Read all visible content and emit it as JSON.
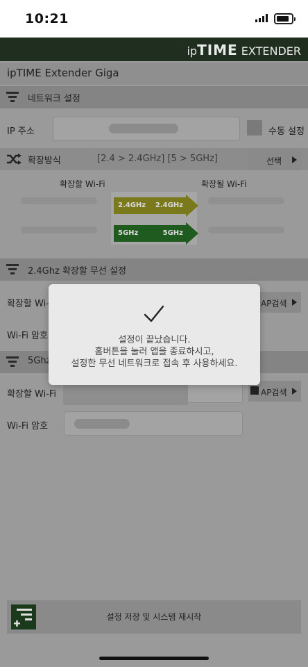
{
  "status_bar": {
    "time": "10:21"
  },
  "brand": {
    "prefix": "ip",
    "name": "TIME",
    "suffix": " EXTENDER"
  },
  "device_name": "ipTIME Extender Giga",
  "network_section": {
    "title": "네트워크 설정",
    "ip_label": "IP 주소",
    "manual_label": "수동 설정"
  },
  "extension_method": {
    "label": "확장방식",
    "value": "[2.4 > 2.4GHz] [5 > 5GHz]",
    "select_label": "선택",
    "source_label": "확장할 Wi-Fi",
    "target_label": "확장될 Wi-Fi",
    "band_24_left": "2.4GHz",
    "band_24_right": "2.4GHz",
    "band_5_left": "5GHz",
    "band_5_right": "5GHz"
  },
  "section_24": {
    "title": "2.4Ghz 확장할 무선 설정",
    "wifi_label": "확장할 Wi-",
    "password_label": "Wi-Fi 암호",
    "ap_search_label": "AP검색"
  },
  "section_5": {
    "title": "5Ghz",
    "wifi_label": "확장할 Wi-Fi",
    "password_label": "Wi-Fi 암호",
    "ap_search_label": "AP검색"
  },
  "toast": {
    "line1": "설정이 끝났습니다.",
    "line2": "홈버튼을 눌러 앱을 종료하시고,",
    "line3": "설정한 무선 네트워크로 접속 후 사용하세요."
  },
  "save_button": {
    "label": "설정 저장 및 시스템 재시작"
  },
  "colors": {
    "header": "#1f2e1f",
    "band_24": "#7a7a1c",
    "band_5": "#1f5a1f",
    "toast_bg": "#e9e9e9"
  }
}
